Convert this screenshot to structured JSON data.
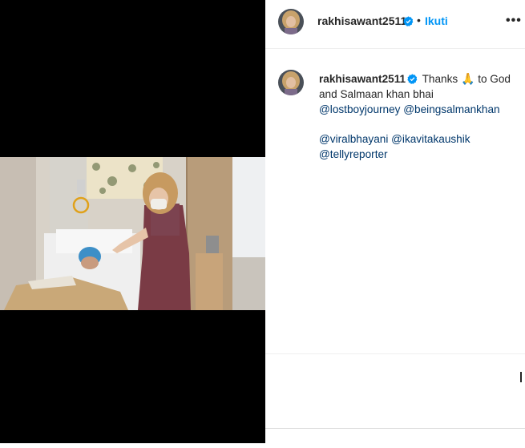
{
  "post": {
    "username": "rakhisawant2511",
    "separator": "•",
    "follow_label": "Ikuti",
    "more_label": "•••",
    "verified_icon": "verified-badge-icon",
    "more_icon": "more-options-icon"
  },
  "caption": {
    "username": "rakhisawant2511",
    "text_before": "Thanks",
    "emoji": "🙏",
    "text_after": "to God and Salmaan khan bhai",
    "mentions_line1": [
      "@lostboyjourney",
      "@beingsalmankhan"
    ],
    "mentions_line2": [
      "@viralbhayani",
      "@ikavitakaushik",
      "@tellyreporter"
    ]
  },
  "colors": {
    "accent": "#0095f6",
    "text": "#262626",
    "mention": "#00376b",
    "media_bg": "#000000"
  }
}
